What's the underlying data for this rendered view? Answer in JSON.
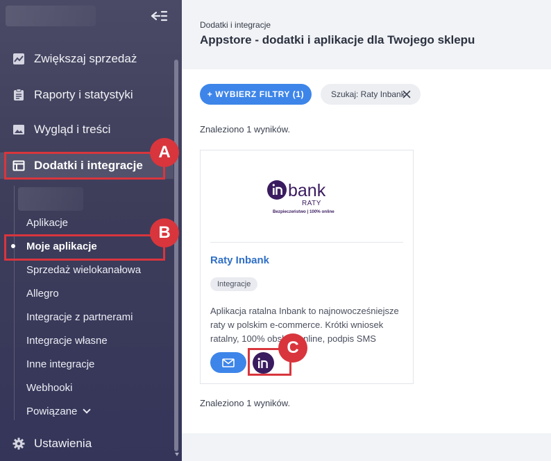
{
  "sidebar": {
    "items": [
      {
        "label": "Zwiększaj sprzedaż",
        "icon": "chart-icon"
      },
      {
        "label": "Raporty i statystyki",
        "icon": "clipboard-icon"
      },
      {
        "label": "Wygląd i treści",
        "icon": "image-icon"
      },
      {
        "label": "Dodatki i integracje",
        "icon": "window-icon",
        "active": true
      }
    ],
    "sub_items": [
      {
        "label": "Aplikacje"
      },
      {
        "label": "Moje aplikacje",
        "current": true
      },
      {
        "label": "Sprzedaż wielokanałowa"
      },
      {
        "label": "Allegro"
      },
      {
        "label": "Integracje z partnerami"
      },
      {
        "label": "Integracje własne"
      },
      {
        "label": "Inne integracje"
      },
      {
        "label": "Webhooki"
      },
      {
        "label": "Powiązane"
      }
    ],
    "settings_label": "Ustawienia"
  },
  "annotations": {
    "a": "A",
    "b": "B",
    "c": "C"
  },
  "header": {
    "breadcrumb": "Dodatki i integracje",
    "title": "Appstore - dodatki i aplikacje dla Twojego sklepu"
  },
  "filters": {
    "button_label": "+ WYBIERZ FILTRY (1)",
    "chip_label": "Szukaj: Raty Inbank"
  },
  "results": {
    "count_text": "Znaleziono 1 wyników.",
    "cards": [
      {
        "logo_word": "bank",
        "logo_sub": "RATY",
        "logo_tagline": "Bezpieczeństwo | 100% online",
        "title": "Raty Inbank",
        "tag": "Integracje",
        "description": "Aplikacja ratalna Inbank to najnowocześniejsze raty w polskim e-commerce. Krótki wniosek ratalny, 100% obsługi online, podpis SMS"
      }
    ]
  },
  "colors": {
    "accent": "#3d85e9",
    "annotation": "#d9353d",
    "brand_inbank": "#3a1b5f",
    "sidebar_bg": "#3d3d5a"
  }
}
